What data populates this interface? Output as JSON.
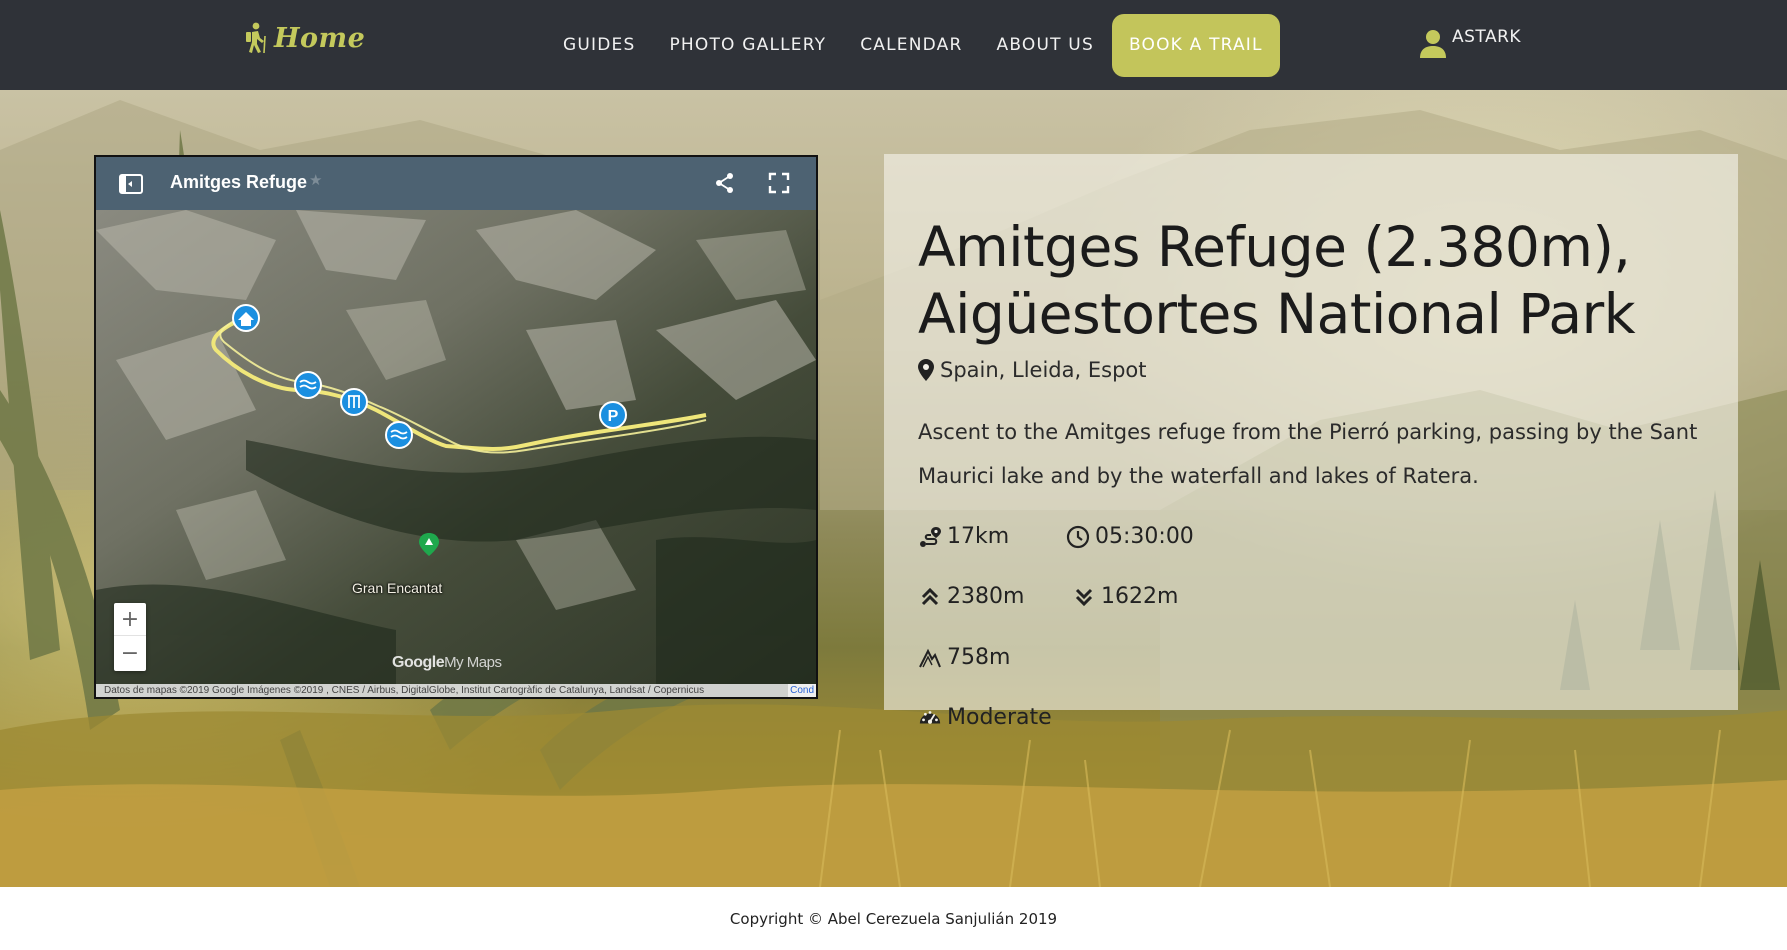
{
  "brand": {
    "label": "Home",
    "icon": "hiker-icon",
    "color": "#c4c95c"
  },
  "nav": {
    "items": [
      {
        "label": "GUIDES"
      },
      {
        "label": "PHOTO GALLERY"
      },
      {
        "label": "CALENDAR"
      },
      {
        "label": "ABOUT US"
      }
    ],
    "cta": {
      "label": "BOOK A TRAIL",
      "color": "#c3c55b"
    },
    "user": {
      "name": "ASTARK",
      "icon": "user-icon"
    }
  },
  "map": {
    "title": "Amitges Refuge",
    "place_label": "Gran Encantat",
    "logo": {
      "brand": "Google",
      "product": "My Maps"
    },
    "zoom_in": "+",
    "zoom_out": "−",
    "attribution": "Datos de mapas ©2019 Google Imágenes ©2019 , CNES / Airbus, DigitalGlobe, Institut Cartogràfic de Catalunya, Landsat / Copernicus",
    "attribution_link": "Cond",
    "markers": [
      "home-marker",
      "lake-marker",
      "waterfall-marker",
      "lake-marker",
      "parking-marker"
    ]
  },
  "trail": {
    "title": "Amitges Refuge (2.380m), Aigüestortes National Park",
    "location": "Spain, Lleida, Espot",
    "description": "Ascent to the Amitges refuge from the Pierró parking, passing by the Sant Maurici lake and by the waterfall and lakes of Ratera.",
    "distance": "17km",
    "duration": "05:30:00",
    "max_altitude": "2380m",
    "min_altitude": "1622m",
    "elevation_gain": "758m",
    "difficulty": "Moderate"
  },
  "footer": {
    "copyright": "Copyright © Abel Cerezuela Sanjulián 2019"
  }
}
